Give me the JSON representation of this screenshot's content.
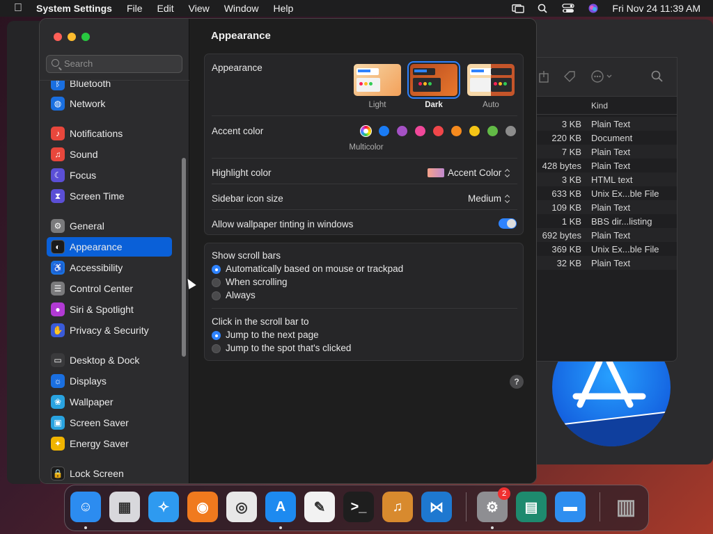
{
  "menubar": {
    "app": "System Settings",
    "items": [
      "File",
      "Edit",
      "View",
      "Window",
      "Help"
    ],
    "datetime": "Fri Nov 24  11:39 AM"
  },
  "window": {
    "search_placeholder": "Search",
    "sidebar": [
      {
        "label": "Bluetooth",
        "icon": "bluetooth-icon",
        "color": "#1a6fe0"
      },
      {
        "label": "Network",
        "icon": "globe-icon",
        "color": "#1a6fe0"
      },
      {
        "label": "Notifications",
        "icon": "bell-icon",
        "color": "#e8473c"
      },
      {
        "label": "Sound",
        "icon": "speaker-icon",
        "color": "#e8473c"
      },
      {
        "label": "Focus",
        "icon": "moon-icon",
        "color": "#5b4fd6"
      },
      {
        "label": "Screen Time",
        "icon": "hourglass-icon",
        "color": "#5b4fd6"
      },
      {
        "label": "General",
        "icon": "gear-icon",
        "color": "#7a7a7c"
      },
      {
        "label": "Appearance",
        "icon": "appearance-icon",
        "color": "#1b1b1b"
      },
      {
        "label": "Accessibility",
        "icon": "accessibility-icon",
        "color": "#1a6fe0"
      },
      {
        "label": "Control Center",
        "icon": "control-center-icon",
        "color": "#7a7a7c"
      },
      {
        "label": "Siri & Spotlight",
        "icon": "siri-icon",
        "color": "#b23ad4"
      },
      {
        "label": "Privacy & Security",
        "icon": "hand-icon",
        "color": "#3a5bd9"
      },
      {
        "label": "Desktop & Dock",
        "icon": "dock-icon",
        "color": "#3a3a3c"
      },
      {
        "label": "Displays",
        "icon": "sun-icon",
        "color": "#1a6fe0"
      },
      {
        "label": "Wallpaper",
        "icon": "flower-icon",
        "color": "#29a3e0"
      },
      {
        "label": "Screen Saver",
        "icon": "screensaver-icon",
        "color": "#29a3e0"
      },
      {
        "label": "Energy Saver",
        "icon": "bulb-icon",
        "color": "#f0b400"
      },
      {
        "label": "Lock Screen",
        "icon": "lock-icon",
        "color": "#1b1b1b"
      }
    ],
    "selected": "Appearance",
    "title": "Appearance",
    "appearance": {
      "label": "Appearance",
      "options": [
        {
          "label": "Light",
          "selected": false
        },
        {
          "label": "Dark",
          "selected": true
        },
        {
          "label": "Auto",
          "selected": false
        }
      ]
    },
    "accent": {
      "label": "Accent color",
      "selected_name": "Multicolor",
      "colors": [
        "multicolor",
        "#1a7cf5",
        "#a551c5",
        "#f0489a",
        "#f0464a",
        "#f58a1e",
        "#f5c516",
        "#62ba46",
        "#8c8c8c"
      ]
    },
    "highlight": {
      "label": "Highlight color",
      "value": "Accent Color"
    },
    "icon_size": {
      "label": "Sidebar icon size",
      "value": "Medium"
    },
    "tinting": {
      "label": "Allow wallpaper tinting in windows",
      "on": true
    },
    "scroll_bars": {
      "label": "Show scroll bars",
      "options": [
        {
          "label": "Automatically based on mouse or trackpad",
          "on": true
        },
        {
          "label": "When scrolling",
          "on": false
        },
        {
          "label": "Always",
          "on": false
        }
      ]
    },
    "click_scroll": {
      "label": "Click in the scroll bar to",
      "options": [
        {
          "label": "Jump to the next page",
          "on": true
        },
        {
          "label": "Jump to the spot that's clicked",
          "on": false
        }
      ]
    },
    "help": "?"
  },
  "finder": {
    "kind_header": "Kind",
    "rows": [
      {
        "size": "3 KB",
        "kind": "Plain Text"
      },
      {
        "size": "220 KB",
        "kind": "Document"
      },
      {
        "size": "7 KB",
        "kind": "Plain Text"
      },
      {
        "size": "428 bytes",
        "kind": "Plain Text"
      },
      {
        "size": "3 KB",
        "kind": "HTML text"
      },
      {
        "size": "633 KB",
        "kind": "Unix Ex...ble File"
      },
      {
        "size": "109 KB",
        "kind": "Plain Text"
      },
      {
        "size": "1 KB",
        "kind": "BBS dir...listing"
      },
      {
        "size": "692 bytes",
        "kind": "Plain Text"
      },
      {
        "size": "369 KB",
        "kind": "Unix Ex...ble File"
      },
      {
        "size": "32 KB",
        "kind": "Plain Text"
      }
    ]
  },
  "dock": {
    "apps": [
      {
        "name": "finder-app",
        "color": "#2c8cf0",
        "running": true
      },
      {
        "name": "launchpad-app",
        "color": "#d8d8dc",
        "running": false
      },
      {
        "name": "safari-app",
        "color": "#2e9af0",
        "running": false
      },
      {
        "name": "firefox-app",
        "color": "#f07a1e",
        "running": false
      },
      {
        "name": "chrome-app",
        "color": "#e8e8e8",
        "running": false
      },
      {
        "name": "app-store-app",
        "color": "#1d8af0",
        "running": true
      },
      {
        "name": "textedit-app",
        "color": "#f2f2f2",
        "running": false
      },
      {
        "name": "terminal-app",
        "color": "#1e1e1e",
        "running": false
      },
      {
        "name": "garageband-app",
        "color": "#d88a2e",
        "running": false
      },
      {
        "name": "vscode-app",
        "color": "#1e78d0",
        "running": false
      },
      {
        "name": "system-settings-app",
        "color": "#8e8e92",
        "running": true,
        "badge": "2"
      },
      {
        "name": "archive-app",
        "color": "#1e8a6e",
        "running": false
      },
      {
        "name": "keynote-app",
        "color": "#2e8ef0",
        "running": false
      },
      {
        "name": "trash-app",
        "color": "#7a7a7e",
        "running": false
      }
    ]
  }
}
